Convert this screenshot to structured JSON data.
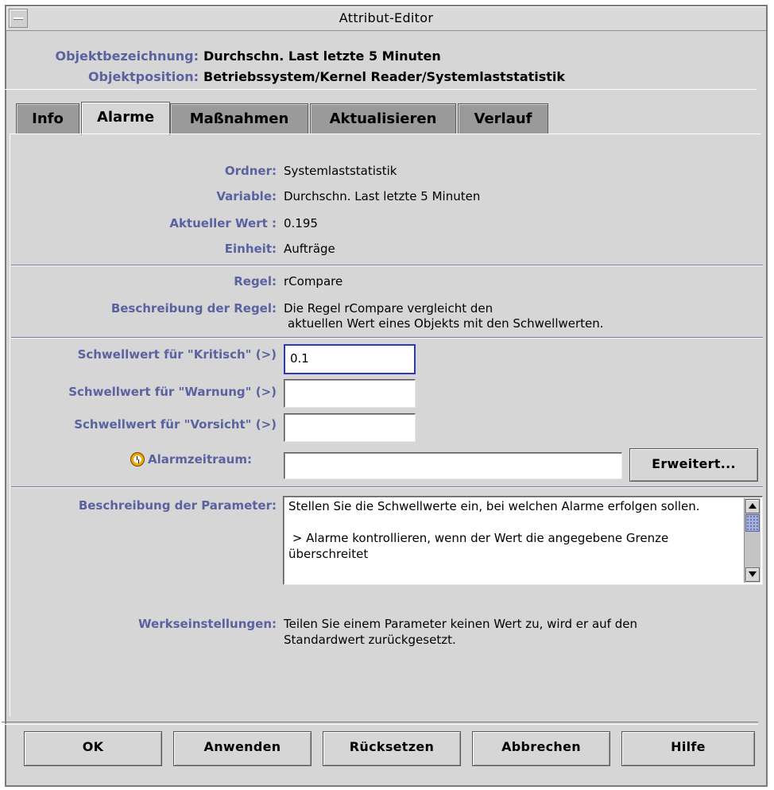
{
  "window": {
    "title": "Attribut-Editor"
  },
  "header": {
    "name_label": "Objektbezeichnung:",
    "name_value": "Durchschn. Last letzte 5 Minuten",
    "position_label": "Objektposition:",
    "position_value": "Betriebssystem/Kernel Reader/Systemlaststatistik"
  },
  "tabs": [
    {
      "label": "Info"
    },
    {
      "label": "Alarme"
    },
    {
      "label": "Maßnahmen"
    },
    {
      "label": "Aktualisieren"
    },
    {
      "label": "Verlauf"
    }
  ],
  "active_tab": "Alarme",
  "details": {
    "folder_label": "Ordner:",
    "folder_value": "Systemlaststatistik",
    "variable_label": "Variable:",
    "variable_value": "Durchschn. Last letzte 5 Minuten",
    "current_label": "Aktueller Wert :",
    "current_value": "0.195",
    "unit_label": "Einheit:",
    "unit_value": "Aufträge"
  },
  "rule": {
    "rule_label": "Regel:",
    "rule_value": "rCompare",
    "desc_label": "Beschreibung der Regel:",
    "desc_line1": "Die Regel rCompare vergleicht den",
    "desc_line2": "aktuellen Wert eines Objekts mit den Schwellwerten."
  },
  "thresholds": {
    "critical_label": "Schwellwert für \"Kritisch\" (>)",
    "critical_value": "0.1",
    "warning_label": "Schwellwert für \"Warnung\" (>)",
    "warning_value": "",
    "caution_label": "Schwellwert für \"Vorsicht\" (>)",
    "caution_value": "",
    "period_label": "Alarmzeitraum:",
    "period_value": "",
    "advanced_button": "Erweitert..."
  },
  "params": {
    "desc_label": "Beschreibung der Parameter:",
    "desc_text": "Stellen Sie die Schwellwerte ein, bei welchen Alarme erfolgen sollen.\n\n > Alarme kontrollieren, wenn der Wert die angegebene Grenze überschreitet",
    "defaults_label": "Werkseinstellungen:",
    "defaults_line1": "Teilen Sie einem Parameter keinen Wert zu, wird er auf den",
    "defaults_line2": "Standardwert zurückgesetzt."
  },
  "buttons": {
    "ok": "OK",
    "apply": "Anwenden",
    "reset": "Rücksetzen",
    "cancel": "Abbrechen",
    "help": "Hilfe"
  },
  "icons": {
    "window_menu": "window-menu-icon",
    "alarm_period": "clock-icon",
    "scroll_up": "arrow-up-icon",
    "scroll_down": "arrow-down-icon"
  },
  "colors": {
    "label": "#5a62a0",
    "background": "#d6d6d6",
    "focus": "#2b3ab8"
  }
}
